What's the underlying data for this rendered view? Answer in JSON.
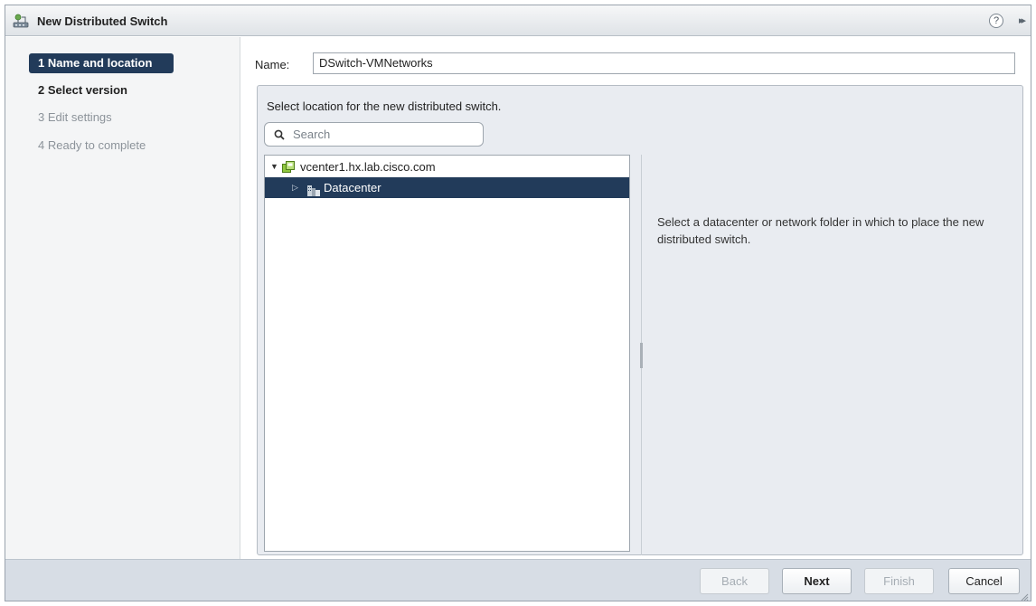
{
  "dialog": {
    "title": "New Distributed Switch",
    "help_symbol": "?",
    "expand_symbol": "▸▸"
  },
  "steps": [
    {
      "label": "1 Name and location",
      "state": "active"
    },
    {
      "label": "2 Select version",
      "state": "enabled"
    },
    {
      "label": "3 Edit settings",
      "state": "disabled"
    },
    {
      "label": "4 Ready to complete",
      "state": "disabled"
    }
  ],
  "name_field": {
    "label": "Name:",
    "value": "DSwitch-VMNetworks"
  },
  "location": {
    "prompt": "Select location for the new distributed switch.",
    "search_placeholder": "Search",
    "tree": [
      {
        "label": "vcenter1.hx.lab.cisco.com",
        "expanded": true,
        "icon": "vcenter-icon"
      },
      {
        "label": "Datacenter",
        "expanded": false,
        "selected": true,
        "icon": "datacenter-icon"
      }
    ],
    "info": "Select a datacenter or network folder in which to place the new distributed switch."
  },
  "footer": {
    "back_label": "Back",
    "next_label": "Next",
    "finish_label": "Finish",
    "cancel_label": "Cancel"
  },
  "colors": {
    "selection": "#223b5a",
    "panel_bg": "#e9ecf1",
    "footer_bg": "#d7dde5"
  }
}
